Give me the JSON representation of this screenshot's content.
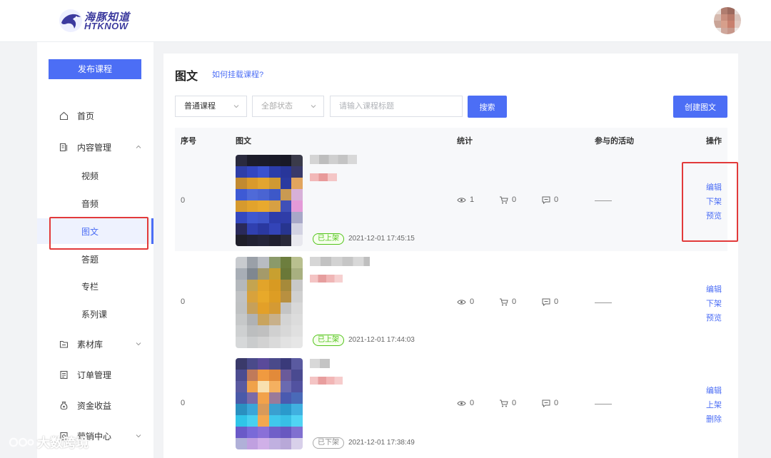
{
  "header": {
    "logo_cn": "海豚知道",
    "logo_en": "HTKNOW"
  },
  "sidebar": {
    "publish_label": "发布课程",
    "items": [
      {
        "label": "首页",
        "icon": "home-icon"
      },
      {
        "label": "内容管理",
        "icon": "content-icon"
      },
      {
        "label": "素材库",
        "icon": "folder-icon"
      },
      {
        "label": "订单管理",
        "icon": "order-icon"
      },
      {
        "label": "资金收益",
        "icon": "money-icon"
      },
      {
        "label": "营销中心",
        "icon": "marketing-icon"
      }
    ],
    "sub_items": [
      "视频",
      "音频",
      "图文",
      "答题",
      "专栏",
      "系列课"
    ],
    "active_sub": "图文"
  },
  "main": {
    "title": "图文",
    "help_link": "如何挂载课程?",
    "filters": {
      "course_type": "普通课程",
      "status": "全部状态",
      "search_placeholder": "请输入课程标题",
      "search_button": "搜索",
      "create_button": "创建图文"
    },
    "table": {
      "headers": [
        "序号",
        "图文",
        "统计",
        "参与的活动",
        "操作"
      ],
      "rows": [
        {
          "index": "0",
          "status": "已上架",
          "time": "2021-12-01 17:45:15",
          "views": "1",
          "cart": "0",
          "comments": "0",
          "activity": "——",
          "ops": [
            "编辑",
            "下架",
            "预览"
          ]
        },
        {
          "index": "0",
          "status": "已上架",
          "time": "2021-12-01 17:44:03",
          "views": "0",
          "cart": "0",
          "comments": "0",
          "activity": "——",
          "ops": [
            "编辑",
            "下架",
            "预览"
          ]
        },
        {
          "index": "0",
          "status": "已下架",
          "time": "2021-12-01 17:38:49",
          "views": "0",
          "cart": "0",
          "comments": "0",
          "activity": "——",
          "ops": [
            "编辑",
            "上架",
            "删除"
          ]
        }
      ]
    }
  },
  "watermark": "大数跨境",
  "colors": {
    "primary": "#4c6ef5",
    "highlight_red": "#e23a3a",
    "on_shelf_green": "#52c41a"
  }
}
